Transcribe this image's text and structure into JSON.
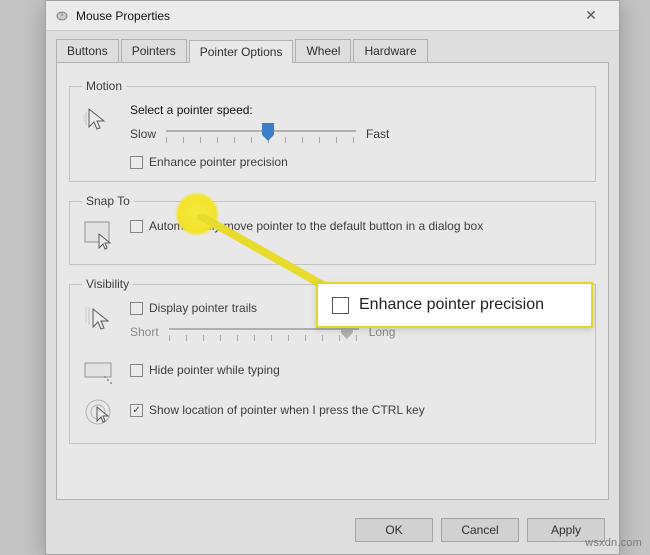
{
  "window": {
    "title": "Mouse Properties"
  },
  "tabs": {
    "items": [
      {
        "label": "Buttons"
      },
      {
        "label": "Pointers"
      },
      {
        "label": "Pointer Options"
      },
      {
        "label": "Wheel"
      },
      {
        "label": "Hardware"
      }
    ],
    "active_index": 2
  },
  "motion": {
    "legend": "Motion",
    "speed_label": "Select a pointer speed:",
    "slow": "Slow",
    "fast": "Fast",
    "speed_value": 6,
    "speed_max": 11,
    "enhance_label": "Enhance pointer precision",
    "enhance_checked": false
  },
  "snap": {
    "legend": "Snap To",
    "auto_label": "Automatically move pointer to the default button in a dialog box",
    "auto_checked": false
  },
  "visibility": {
    "legend": "Visibility",
    "trails_label": "Display pointer trails",
    "trails_checked": false,
    "short": "Short",
    "long": "Long",
    "trail_value": 10,
    "trail_max": 11,
    "hide_label": "Hide pointer while typing",
    "hide_checked": false,
    "ctrl_label": "Show location of pointer when I press the CTRL key",
    "ctrl_checked": true
  },
  "buttons": {
    "ok": "OK",
    "cancel": "Cancel",
    "apply": "Apply"
  },
  "callout": {
    "label": "Enhance pointer precision",
    "checked": false
  },
  "watermark": "wsxdn.com"
}
